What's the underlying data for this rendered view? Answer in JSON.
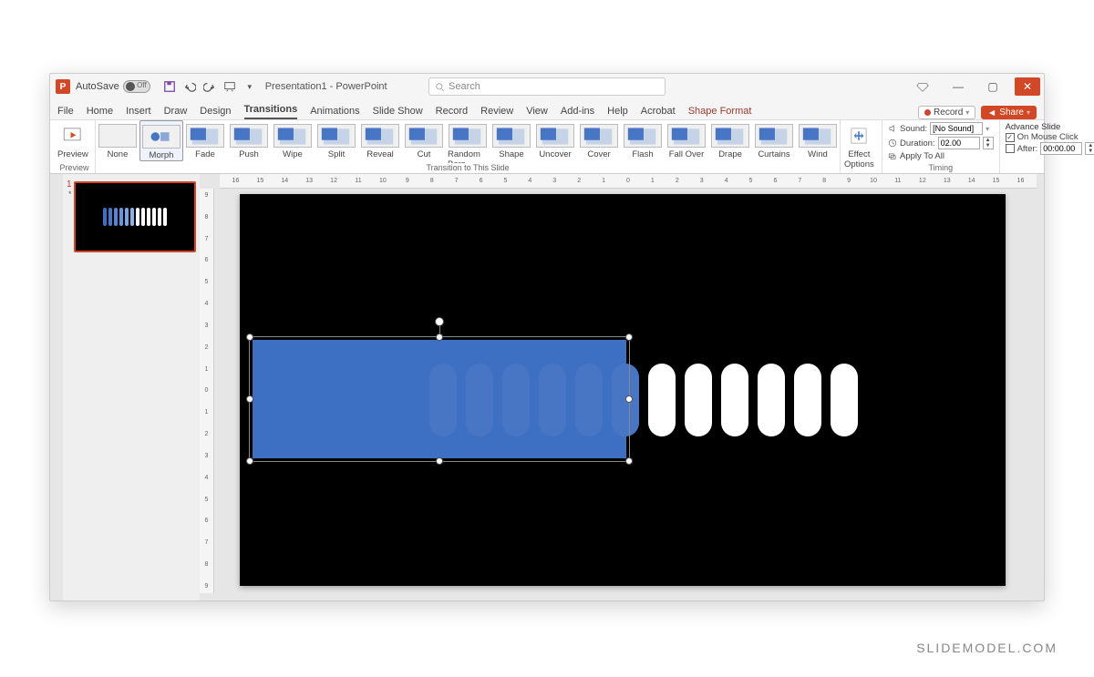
{
  "titlebar": {
    "autosave_label": "AutoSave",
    "autosave_state": "Off",
    "doc_title": "Presentation1 - PowerPoint",
    "search_placeholder": "Search"
  },
  "win": {
    "minimize": "—",
    "maximize": "▢",
    "close": "✕"
  },
  "tabs": {
    "file": "File",
    "home": "Home",
    "insert": "Insert",
    "draw": "Draw",
    "design": "Design",
    "transitions": "Transitions",
    "animations": "Animations",
    "slideshow": "Slide Show",
    "record": "Record",
    "review": "Review",
    "view": "View",
    "addins": "Add-ins",
    "help": "Help",
    "acrobat": "Acrobat",
    "shape_format": "Shape Format",
    "record_btn": "Record",
    "share_btn": "Share"
  },
  "ribbon": {
    "preview_btn": "Preview",
    "preview_group": "Preview",
    "transitions": [
      "None",
      "Morph",
      "Fade",
      "Push",
      "Wipe",
      "Split",
      "Reveal",
      "Cut",
      "Random Bars",
      "Shape",
      "Uncover",
      "Cover",
      "Flash",
      "Fall Over",
      "Drape",
      "Curtains",
      "Wind"
    ],
    "selected_transition_index": 1,
    "transitions_group_label": "Transition to This Slide",
    "effect_options": "Effect\nOptions",
    "sound_label": "Sound:",
    "sound_value": "[No Sound]",
    "duration_label": "Duration:",
    "duration_value": "02.00",
    "apply_all": "Apply To All",
    "timing_group": "Timing",
    "advance_label": "Advance Slide",
    "on_click_label": "On Mouse Click",
    "on_click_checked": true,
    "after_label": "After:",
    "after_value": "00:00.00",
    "after_checked": false
  },
  "thumb": {
    "slide_num": "1",
    "star": "*"
  },
  "ruler": {
    "h": [
      "16",
      "15",
      "14",
      "13",
      "12",
      "11",
      "10",
      "9",
      "8",
      "7",
      "6",
      "5",
      "4",
      "3",
      "2",
      "1",
      "0",
      "1",
      "2",
      "3",
      "4",
      "5",
      "6",
      "7",
      "8",
      "9",
      "10",
      "11",
      "12",
      "13",
      "14",
      "15",
      "16"
    ],
    "v": [
      "9",
      "8",
      "7",
      "6",
      "5",
      "4",
      "3",
      "2",
      "1",
      "0",
      "1",
      "2",
      "3",
      "4",
      "5",
      "6",
      "7",
      "8",
      "9"
    ]
  },
  "pills": {
    "blue_count": 6,
    "white_count": 6
  },
  "watermark": "SLIDEMODEL.COM"
}
